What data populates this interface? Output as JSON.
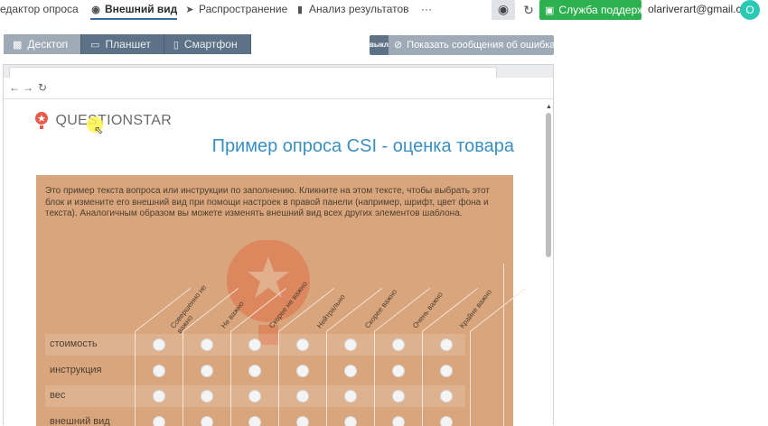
{
  "nav": {
    "items": [
      {
        "label": "едактор опроса",
        "icon": ""
      },
      {
        "label": "Внешний вид",
        "icon": "palette-icon"
      },
      {
        "label": "Распространение",
        "icon": "paper-plane-icon"
      },
      {
        "label": "Анализ результатов",
        "icon": "bar-chart-icon"
      },
      {
        "label": "···",
        "icon": ""
      }
    ],
    "support_label": "Служба поддержки",
    "user_email": "olariverart@gmail.com",
    "avatar_letter": "O"
  },
  "devices": {
    "items": [
      "Десктоп",
      "Планшет",
      "Смартфон"
    ],
    "selected": "Десктоп"
  },
  "errors_toggle": {
    "state": "выкл",
    "label": "Показать сообщения об ошибках"
  },
  "preview": {
    "logo_text": "QUESTIONSTAR",
    "title": "Пример опроса CSI - оценка товара",
    "intro": "Это пример текста вопроса или инструкции по заполнению. Кликните на этом тексте, чтобы выбрать этот блок и измените его внешний вид при помощи настроек в правой панели (например, шрифт, цвет фона и текста). Аналогичным образом вы можете изменять внешний вид всех других элементов шаблона.",
    "columns": [
      "Совершенно не\nважно",
      "Не важно",
      "Скорее не важно",
      "Нейтрально",
      "Скорее важно",
      "Очень важно",
      "Крайне важно"
    ],
    "rows": [
      "стоимость",
      "инструкция",
      "вес",
      "внешний вид"
    ]
  },
  "colors": {
    "accent": "#3a8fbf",
    "support_green": "#2db04f",
    "card_bg": "#d9a57d",
    "avatar": "#2bc9b4"
  }
}
